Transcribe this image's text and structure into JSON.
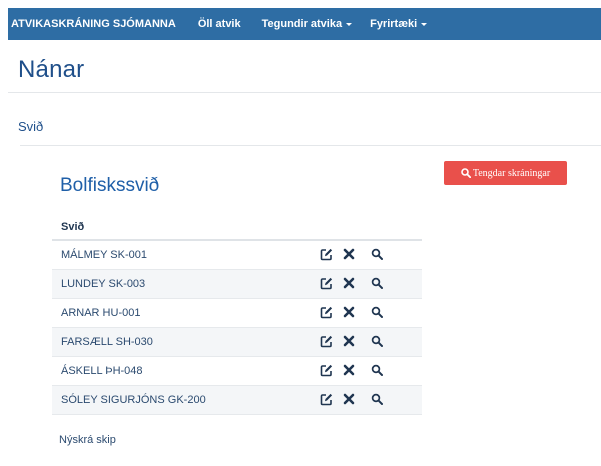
{
  "navbar": {
    "brand": "ATVIKASKRÁNING SJÓMANNA",
    "items": [
      {
        "label": "Öll atvik",
        "dropdown": false
      },
      {
        "label": "Tegundir atvika",
        "dropdown": true
      },
      {
        "label": "Fyrirtæki",
        "dropdown": true
      }
    ]
  },
  "page": {
    "title": "Nánar",
    "section_label": "Svið"
  },
  "panel": {
    "title": "Bolfiskssvið",
    "related_button_label": "Tengdar skráningar",
    "table": {
      "column_header": "Svið",
      "rows": [
        {
          "name": "MÁLMEY SK-001"
        },
        {
          "name": "LUNDEY SK-003"
        },
        {
          "name": "ARNAR HU-001"
        },
        {
          "name": "FARSÆLL SH-030"
        },
        {
          "name": "ÁSKELL ÞH-048"
        },
        {
          "name": "SÓLEY SIGURJÓNS GK-200"
        }
      ]
    },
    "new_link_label": "Nýskrá skip"
  },
  "colors": {
    "navbar_bg": "#2e6da4",
    "title_blue": "#1f4f8a",
    "button_red": "#e9504b",
    "row_alt": "#f4f6f8"
  },
  "icons": {
    "edit": "edit-icon",
    "delete": "close-icon",
    "view": "search-icon"
  }
}
